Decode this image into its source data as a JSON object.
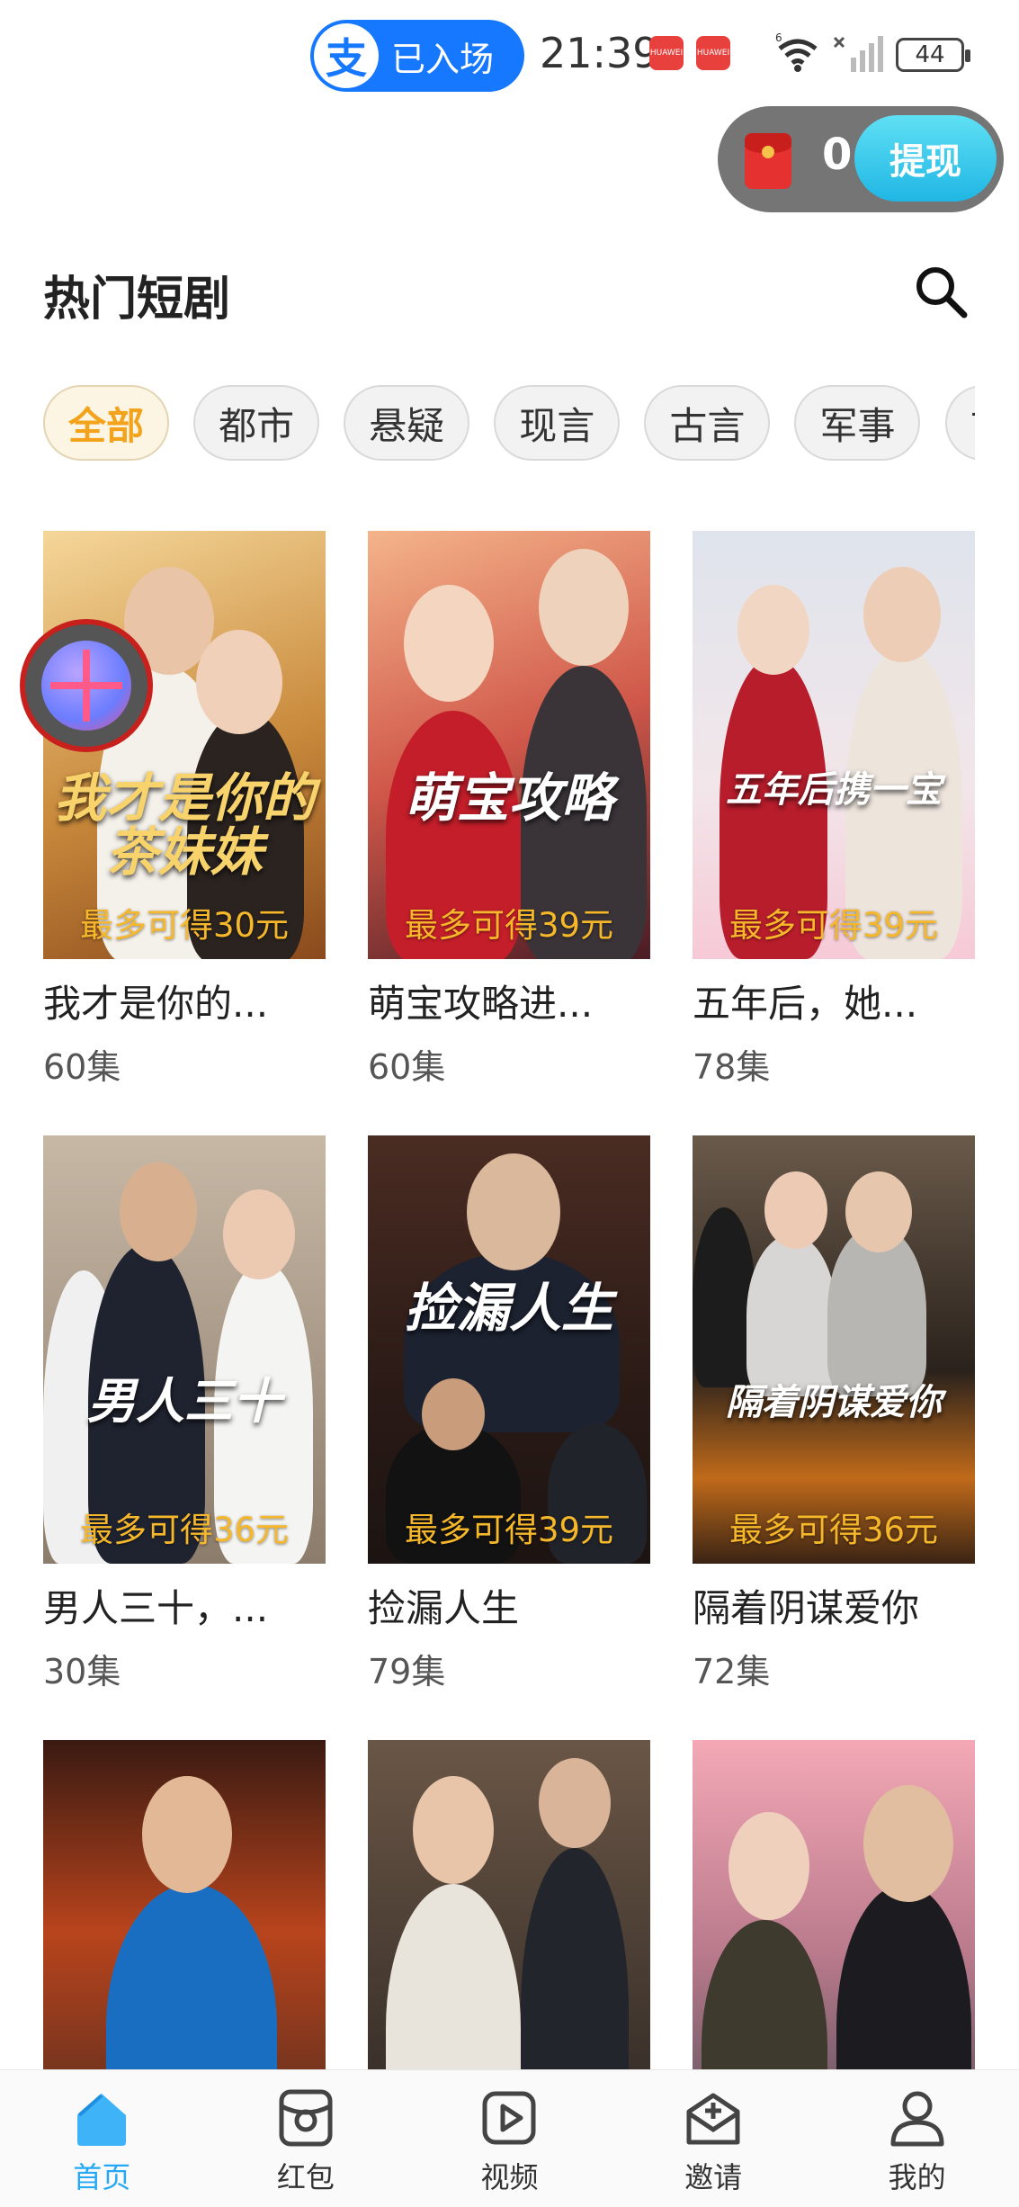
{
  "status_bar": {
    "alipay_logo": "支",
    "alipay_status": "已入场",
    "time": "21:39",
    "notification_brand": "HUAWEI",
    "network": "6",
    "battery": "44"
  },
  "wallet": {
    "icon": "red-envelope-icon",
    "balance": "0",
    "withdraw_label": "提现"
  },
  "header": {
    "title": "热门短剧",
    "search_icon": "search-icon"
  },
  "categories": [
    {
      "label": "全部",
      "active": true
    },
    {
      "label": "都市"
    },
    {
      "label": "悬疑"
    },
    {
      "label": "现言"
    },
    {
      "label": "古言"
    },
    {
      "label": "军事"
    },
    {
      "label": "玄幻"
    }
  ],
  "dramas": [
    {
      "title": "我才是你的...",
      "episodes": "60集",
      "poster_title": "我才是你的茶妹妹",
      "reward": "最多可得30元"
    },
    {
      "title": "萌宝攻略进...",
      "episodes": "60集",
      "poster_title": "萌宝攻略",
      "reward": "最多可得39元"
    },
    {
      "title": "五年后，她...",
      "episodes": "78集",
      "poster_title": "五年后携一宝",
      "reward": "最多可得39元"
    },
    {
      "title": "男人三十，...",
      "episodes": "30集",
      "poster_title": "男人三十",
      "reward": "最多可得36元"
    },
    {
      "title": "捡漏人生",
      "episodes": "79集",
      "poster_title": "捡漏人生",
      "reward": "最多可得39元"
    },
    {
      "title": "隔着阴谋爱你",
      "episodes": "72集",
      "poster_title": "隔着阴谋爱你",
      "reward": "最多可得36元"
    },
    {
      "title": "",
      "episodes": "",
      "poster_title": "",
      "reward": ""
    },
    {
      "title": "",
      "episodes": "",
      "poster_title": "",
      "reward": ""
    },
    {
      "title": "",
      "episodes": "",
      "poster_title": "",
      "reward": ""
    }
  ],
  "floating_gift": {
    "icon": "gift-icon"
  },
  "tabs": [
    {
      "label": "首页",
      "icon": "home-icon",
      "active": true
    },
    {
      "label": "红包",
      "icon": "red-packet-icon"
    },
    {
      "label": "视频",
      "icon": "video-icon"
    },
    {
      "label": "邀请",
      "icon": "invite-icon"
    },
    {
      "label": "我的",
      "icon": "profile-icon"
    }
  ],
  "colors": {
    "accent": "#25a8f5",
    "chip_active_text": "#f2a31b",
    "reward_text": "#f6b82a",
    "alipay_blue": "#1677ff",
    "withdraw_button": "#20b6e4"
  }
}
